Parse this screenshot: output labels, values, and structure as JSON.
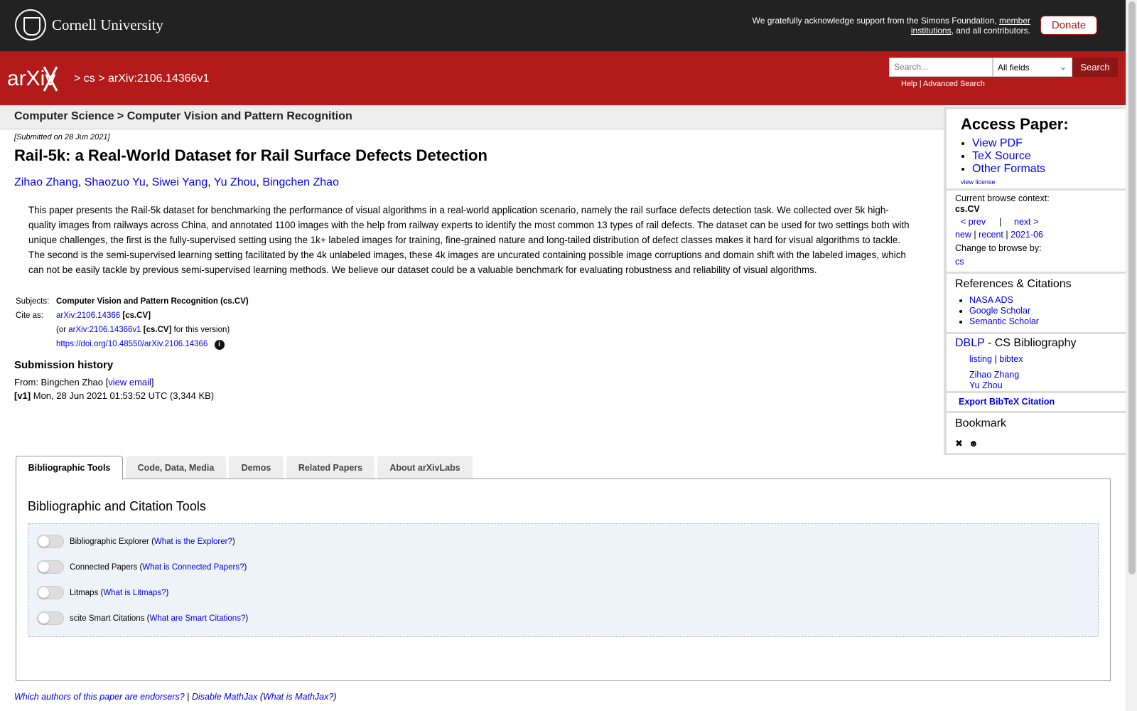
{
  "header": {
    "university": "Cornell University",
    "support_prefix": "We gratefully acknowledge support from the Simons Foundation,",
    "support_link": "member institutions",
    "support_suffix": ", and all contributors.",
    "donate_label": "Donate"
  },
  "redbar": {
    "logo_text": "arXiv",
    "breadcrumb": "> cs > arXiv:2106.14366v1",
    "search_placeholder": "Search...",
    "search_field": "All fields",
    "search_button": "Search",
    "help": "Help",
    "sep": "|",
    "advanced": "Advanced Search"
  },
  "subheader": "Computer Science > Computer Vision and Pattern Recognition",
  "paper": {
    "submitted": "[Submitted on 28 Jun 2021]",
    "title": "Rail-5k: a Real-World Dataset for Rail Surface Defects Detection",
    "authors": [
      "Zihao Zhang",
      "Shaozuo Yu",
      "Siwei Yang",
      "Yu Zhou",
      "Bingchen Zhao"
    ],
    "abstract": "This paper presents the Rail-5k dataset for benchmarking the performance of visual algorithms in a real-world application scenario, namely the rail surface defects detection task. We collected over 5k high-quality images from railways across China, and annotated 1100 images with the help from railway experts to identify the most common 13 types of rail defects. The dataset can be used for two settings both with unique challenges, the first is the fully-supervised setting using the 1k+ labeled images for training, fine-grained nature and long-tailed distribution of defect classes makes it hard for visual algorithms to tackle. The second is the semi-supervised learning setting facilitated by the 4k unlabeled images, these 4k images are uncurated containing possible image corruptions and domain shift with the labeled images, which can not be easily tackle by previous semi-supervised learning methods. We believe our dataset could be a valuable benchmark for evaluating robustness and reliability of visual algorithms."
  },
  "meta": {
    "subjects_label": "Subjects:",
    "subjects_value": "Computer Vision and Pattern Recognition (cs.CV)",
    "cite_label": "Cite as:",
    "cite_id": "arXiv:2106.14366",
    "cite_cat": "[cs.CV]",
    "or_prefix": "(or",
    "version_id": "arXiv:2106.14366v1",
    "version_cat": "[cs.CV]",
    "version_suffix": "for this version)",
    "doi": "https://doi.org/10.48550/arXiv.2106.14366",
    "info_glyph": "i"
  },
  "history": {
    "heading": "Submission history",
    "from_prefix": "From: Bingchen Zhao [",
    "view_email": "view email",
    "from_suffix": "]",
    "v1_label": "[v1]",
    "v1_text": "Mon, 28 Jun 2021 01:53:52 UTC (3,344 KB)"
  },
  "sidebar": {
    "access_title": "Access Paper:",
    "access_links": [
      "View PDF",
      "TeX Source",
      "Other Formats"
    ],
    "view_license": "view license",
    "context_label": "Current browse context:",
    "context_value": "cs.CV",
    "prev": "< prev",
    "pipe": "|",
    "next": "next >",
    "new": "new",
    "recent": "recent",
    "month": "2021-06",
    "change_label": "Change to browse by:",
    "change_cs": "cs",
    "refs_title": "References & Citations",
    "refs_links": [
      "NASA ADS",
      "Google Scholar",
      "Semantic Scholar"
    ],
    "dblp": "DBLP",
    "dblp_suffix": "- CS Bibliography",
    "listing": "listing",
    "bibtex": "bibtex",
    "dblp_authors": [
      "Zihao Zhang",
      "Yu Zhou"
    ],
    "export": "Export BibTeX Citation",
    "bookmark": "Bookmark"
  },
  "tabs": [
    "Bibliographic Tools",
    "Code, Data, Media",
    "Demos",
    "Related Papers",
    "About arXivLabs"
  ],
  "panel": {
    "heading": "Bibliographic and Citation Tools",
    "tools": [
      {
        "label": "Bibliographic Explorer",
        "link": "What is the Explorer?"
      },
      {
        "label": "Connected Papers",
        "link": "What is Connected Papers?"
      },
      {
        "label": "Litmaps",
        "link": "What is Litmaps?"
      },
      {
        "label": "scite Smart Citations",
        "link": "What are Smart Citations?"
      }
    ]
  },
  "footer": {
    "endorsers": "Which authors of this paper are endorsers?",
    "pipe": "|",
    "mathjax": "Disable MathJax",
    "what_mathjax": "What is MathJax?"
  }
}
